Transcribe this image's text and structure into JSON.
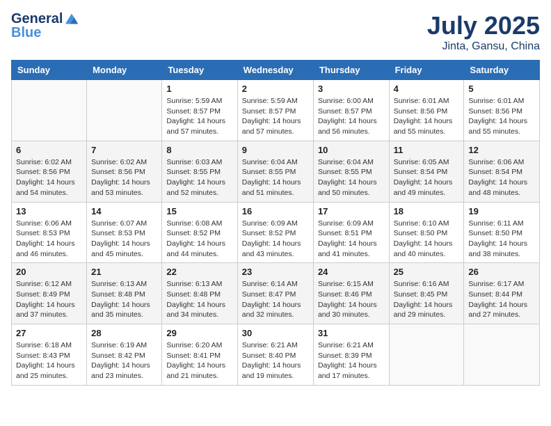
{
  "logo": {
    "line1": "General",
    "line2": "Blue"
  },
  "title": "July 2025",
  "subtitle": "Jinta, Gansu, China",
  "weekdays": [
    "Sunday",
    "Monday",
    "Tuesday",
    "Wednesday",
    "Thursday",
    "Friday",
    "Saturday"
  ],
  "weeks": [
    [
      {
        "day": "",
        "empty": true
      },
      {
        "day": "",
        "empty": true
      },
      {
        "day": "1",
        "sunrise": "Sunrise: 5:59 AM",
        "sunset": "Sunset: 8:57 PM",
        "daylight": "Daylight: 14 hours and 57 minutes."
      },
      {
        "day": "2",
        "sunrise": "Sunrise: 5:59 AM",
        "sunset": "Sunset: 8:57 PM",
        "daylight": "Daylight: 14 hours and 57 minutes."
      },
      {
        "day": "3",
        "sunrise": "Sunrise: 6:00 AM",
        "sunset": "Sunset: 8:57 PM",
        "daylight": "Daylight: 14 hours and 56 minutes."
      },
      {
        "day": "4",
        "sunrise": "Sunrise: 6:01 AM",
        "sunset": "Sunset: 8:56 PM",
        "daylight": "Daylight: 14 hours and 55 minutes."
      },
      {
        "day": "5",
        "sunrise": "Sunrise: 6:01 AM",
        "sunset": "Sunset: 8:56 PM",
        "daylight": "Daylight: 14 hours and 55 minutes."
      }
    ],
    [
      {
        "day": "6",
        "sunrise": "Sunrise: 6:02 AM",
        "sunset": "Sunset: 8:56 PM",
        "daylight": "Daylight: 14 hours and 54 minutes."
      },
      {
        "day": "7",
        "sunrise": "Sunrise: 6:02 AM",
        "sunset": "Sunset: 8:56 PM",
        "daylight": "Daylight: 14 hours and 53 minutes."
      },
      {
        "day": "8",
        "sunrise": "Sunrise: 6:03 AM",
        "sunset": "Sunset: 8:55 PM",
        "daylight": "Daylight: 14 hours and 52 minutes."
      },
      {
        "day": "9",
        "sunrise": "Sunrise: 6:04 AM",
        "sunset": "Sunset: 8:55 PM",
        "daylight": "Daylight: 14 hours and 51 minutes."
      },
      {
        "day": "10",
        "sunrise": "Sunrise: 6:04 AM",
        "sunset": "Sunset: 8:55 PM",
        "daylight": "Daylight: 14 hours and 50 minutes."
      },
      {
        "day": "11",
        "sunrise": "Sunrise: 6:05 AM",
        "sunset": "Sunset: 8:54 PM",
        "daylight": "Daylight: 14 hours and 49 minutes."
      },
      {
        "day": "12",
        "sunrise": "Sunrise: 6:06 AM",
        "sunset": "Sunset: 8:54 PM",
        "daylight": "Daylight: 14 hours and 48 minutes."
      }
    ],
    [
      {
        "day": "13",
        "sunrise": "Sunrise: 6:06 AM",
        "sunset": "Sunset: 8:53 PM",
        "daylight": "Daylight: 14 hours and 46 minutes."
      },
      {
        "day": "14",
        "sunrise": "Sunrise: 6:07 AM",
        "sunset": "Sunset: 8:53 PM",
        "daylight": "Daylight: 14 hours and 45 minutes."
      },
      {
        "day": "15",
        "sunrise": "Sunrise: 6:08 AM",
        "sunset": "Sunset: 8:52 PM",
        "daylight": "Daylight: 14 hours and 44 minutes."
      },
      {
        "day": "16",
        "sunrise": "Sunrise: 6:09 AM",
        "sunset": "Sunset: 8:52 PM",
        "daylight": "Daylight: 14 hours and 43 minutes."
      },
      {
        "day": "17",
        "sunrise": "Sunrise: 6:09 AM",
        "sunset": "Sunset: 8:51 PM",
        "daylight": "Daylight: 14 hours and 41 minutes."
      },
      {
        "day": "18",
        "sunrise": "Sunrise: 6:10 AM",
        "sunset": "Sunset: 8:50 PM",
        "daylight": "Daylight: 14 hours and 40 minutes."
      },
      {
        "day": "19",
        "sunrise": "Sunrise: 6:11 AM",
        "sunset": "Sunset: 8:50 PM",
        "daylight": "Daylight: 14 hours and 38 minutes."
      }
    ],
    [
      {
        "day": "20",
        "sunrise": "Sunrise: 6:12 AM",
        "sunset": "Sunset: 8:49 PM",
        "daylight": "Daylight: 14 hours and 37 minutes."
      },
      {
        "day": "21",
        "sunrise": "Sunrise: 6:13 AM",
        "sunset": "Sunset: 8:48 PM",
        "daylight": "Daylight: 14 hours and 35 minutes."
      },
      {
        "day": "22",
        "sunrise": "Sunrise: 6:13 AM",
        "sunset": "Sunset: 8:48 PM",
        "daylight": "Daylight: 14 hours and 34 minutes."
      },
      {
        "day": "23",
        "sunrise": "Sunrise: 6:14 AM",
        "sunset": "Sunset: 8:47 PM",
        "daylight": "Daylight: 14 hours and 32 minutes."
      },
      {
        "day": "24",
        "sunrise": "Sunrise: 6:15 AM",
        "sunset": "Sunset: 8:46 PM",
        "daylight": "Daylight: 14 hours and 30 minutes."
      },
      {
        "day": "25",
        "sunrise": "Sunrise: 6:16 AM",
        "sunset": "Sunset: 8:45 PM",
        "daylight": "Daylight: 14 hours and 29 minutes."
      },
      {
        "day": "26",
        "sunrise": "Sunrise: 6:17 AM",
        "sunset": "Sunset: 8:44 PM",
        "daylight": "Daylight: 14 hours and 27 minutes."
      }
    ],
    [
      {
        "day": "27",
        "sunrise": "Sunrise: 6:18 AM",
        "sunset": "Sunset: 8:43 PM",
        "daylight": "Daylight: 14 hours and 25 minutes."
      },
      {
        "day": "28",
        "sunrise": "Sunrise: 6:19 AM",
        "sunset": "Sunset: 8:42 PM",
        "daylight": "Daylight: 14 hours and 23 minutes."
      },
      {
        "day": "29",
        "sunrise": "Sunrise: 6:20 AM",
        "sunset": "Sunset: 8:41 PM",
        "daylight": "Daylight: 14 hours and 21 minutes."
      },
      {
        "day": "30",
        "sunrise": "Sunrise: 6:21 AM",
        "sunset": "Sunset: 8:40 PM",
        "daylight": "Daylight: 14 hours and 19 minutes."
      },
      {
        "day": "31",
        "sunrise": "Sunrise: 6:21 AM",
        "sunset": "Sunset: 8:39 PM",
        "daylight": "Daylight: 14 hours and 17 minutes."
      },
      {
        "day": "",
        "empty": true
      },
      {
        "day": "",
        "empty": true
      }
    ]
  ]
}
